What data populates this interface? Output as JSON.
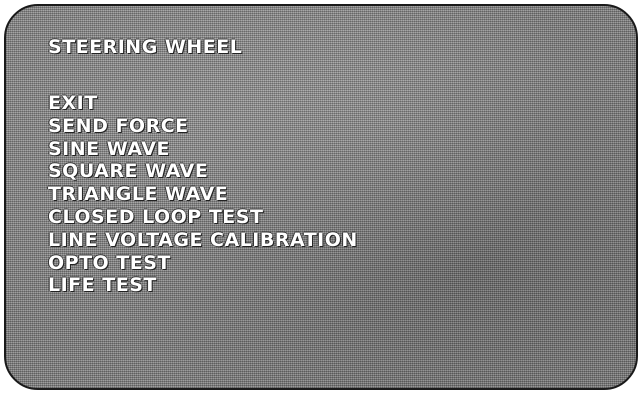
{
  "screen": {
    "title": "STEERING WHEEL"
  },
  "menu": {
    "items": [
      "EXIT",
      "SEND FORCE",
      "SINE WAVE",
      "SQUARE WAVE",
      "TRIANGLE WAVE",
      "CLOSED LOOP TEST",
      "LINE VOLTAGE CALIBRATION",
      "OPTO TEST",
      "LIFE TEST"
    ]
  }
}
